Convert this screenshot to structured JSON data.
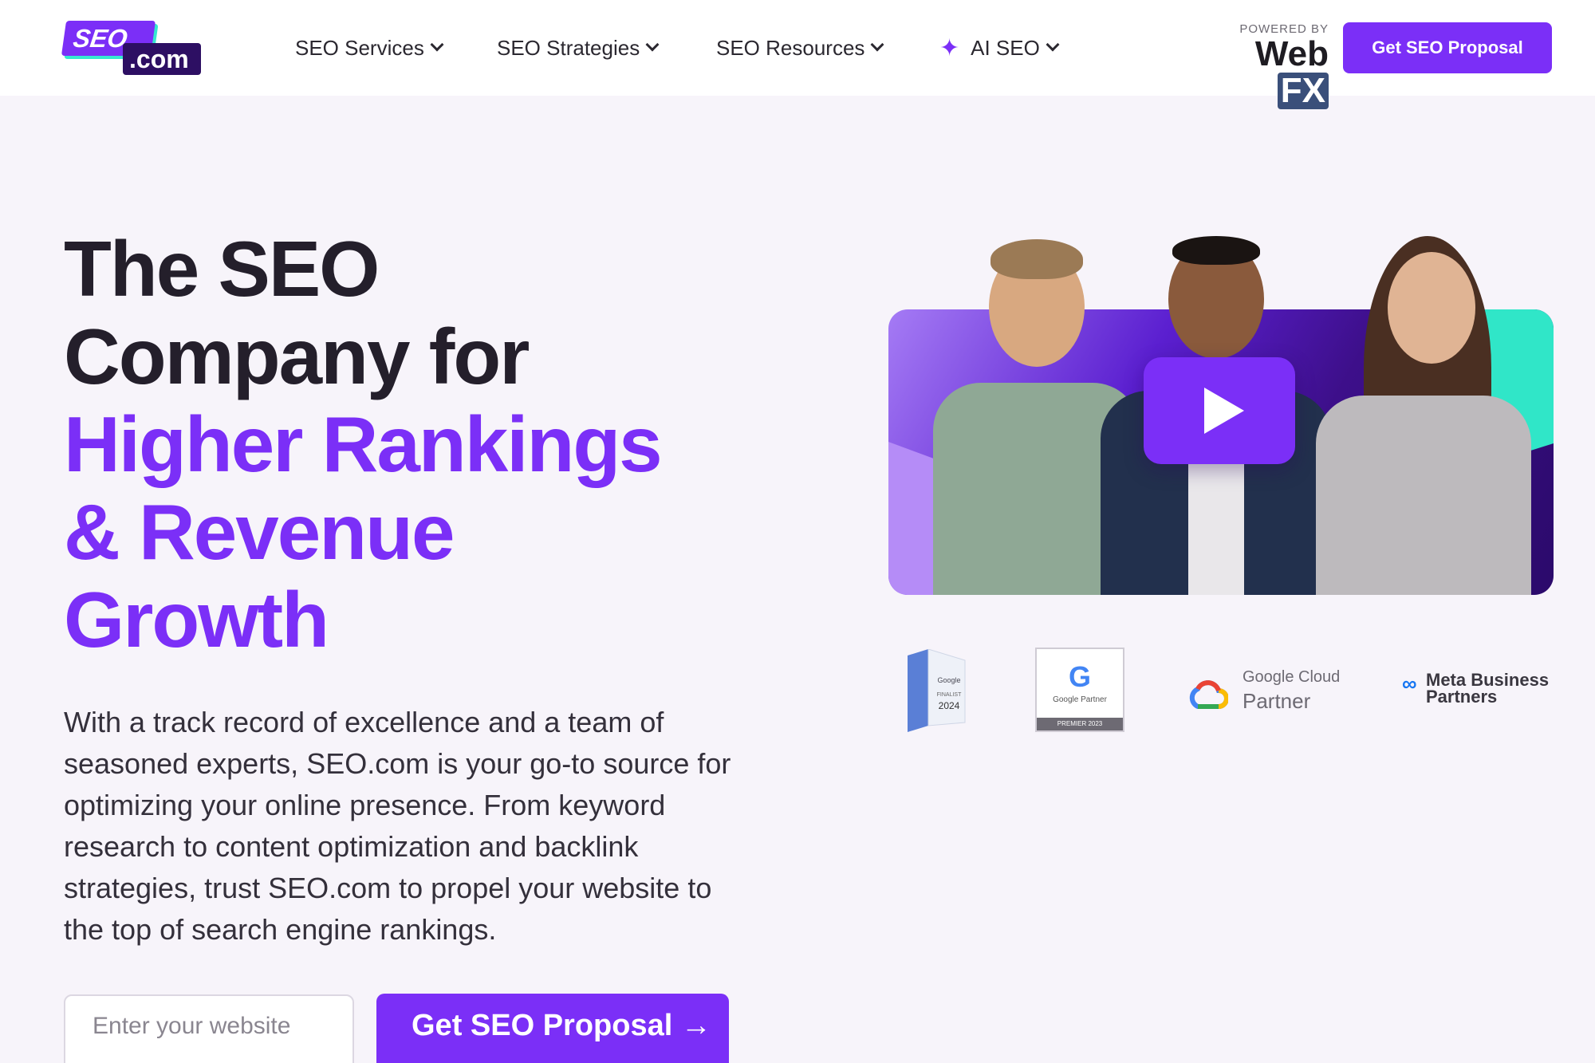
{
  "logo": {
    "part1": "SEO",
    "part2": ".com"
  },
  "nav": [
    {
      "label": "SEO Services"
    },
    {
      "label": "SEO Strategies"
    },
    {
      "label": "SEO Resources"
    },
    {
      "label": "AI SEO"
    }
  ],
  "powered_by": {
    "label": "POWERED BY",
    "brand_a": "Web",
    "brand_b": "FX"
  },
  "header_cta": "Get SEO Proposal",
  "hero": {
    "line1": "The SEO",
    "line2": "Company for",
    "line3": "Higher Rankings",
    "line4": "& Revenue",
    "line5": "Growth",
    "description": "With a track record of excellence and a team of seasoned experts, SEO.com is your go-to source for optimizing your online presence. From keyword research to content optimization and backlink strategies, trust SEO.com to propel your website to the top of search engine rankings.",
    "input_placeholder": "Enter your website",
    "cta_label": "Get SEO Proposal →"
  },
  "badges": {
    "google_finalist": {
      "brand": "Google",
      "label": "FINALIST",
      "year": "2024"
    },
    "google_partner": {
      "mark": "G",
      "label": "Google Partner",
      "strip": "PREMIER 2023"
    },
    "google_cloud": {
      "line1": "Google Cloud",
      "line2": "Partner"
    },
    "meta": {
      "mark": "∞",
      "line1": "Meta Business",
      "line2": "Partners"
    }
  },
  "colors": {
    "accent": "#7b2ff7",
    "teal": "#30e6c8",
    "dark_purple": "#2b0a6b",
    "text": "#241f2b"
  }
}
